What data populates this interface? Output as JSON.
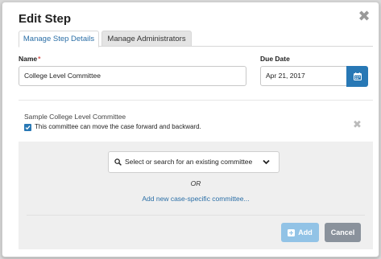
{
  "modal": {
    "title": "Edit Step",
    "close_icon": "close-x-icon"
  },
  "tabs": [
    {
      "label": "Manage Step Details",
      "active": true
    },
    {
      "label": "Manage Administrators",
      "active": false
    }
  ],
  "form": {
    "name_label": "Name",
    "name_required_mark": "*",
    "name_value": "College Level Committee",
    "due_date_label": "Due Date",
    "due_date_value": "Apr 21, 2017",
    "calendar_icon": "calendar-icon"
  },
  "committee": {
    "name": "Sample College Level Committee",
    "checkbox_checked": true,
    "checkbox_label": "This committee can move the case forward and backward.",
    "remove_icon": "remove-x-icon"
  },
  "panel": {
    "select_placeholder": "Select or search for an existing committee",
    "or_text": "OR",
    "add_link": "Add new case-specific committee...",
    "add_button": "Add",
    "cancel_button": "Cancel"
  },
  "colors": {
    "primary": "#2878b5",
    "add_button_disabled": "#92c3e6",
    "cancel_button": "#8a929c",
    "link": "#2a6ea6",
    "required": "#d9534f"
  }
}
